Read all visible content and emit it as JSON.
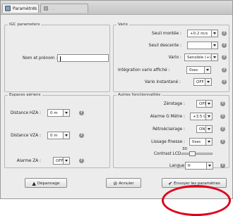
{
  "window": {
    "tab_active": "Paramètres",
    "tab_inactive": "…"
  },
  "igc": {
    "title": "IGC parameters",
    "name_label": "Nom et prénom :",
    "name_value": ""
  },
  "vario": {
    "title": "Vario",
    "seuil_montee_label": "Seuil montée :",
    "seuil_montee_value": "+0.2 m/s",
    "seuil_descente_label": "Seuil descente :",
    "seuil_descente_value": "",
    "vario_label": "Vario :",
    "vario_value": "Sensible (+)",
    "integration_label": "Intégration vario affiché :",
    "integration_value": "0sec",
    "instantane_label": "Vario instantané :",
    "instantane_value": "OFF"
  },
  "espaces": {
    "title": "Espaces aériens",
    "hza_label": "Distance HZA :",
    "hza_value": "0 m",
    "vza_label": "Distance VZA :",
    "vza_value": "0 m",
    "alarme_label": "Alarme ZA :",
    "alarme_value": "OFF"
  },
  "autres": {
    "title": "Autres fonctionnalités",
    "zerotage_label": "Zérotage :",
    "zerotage_value": "OFF",
    "alarme_g_label": "Alarme G Mètre :",
    "alarme_g_value": "+3.5 G",
    "retro_label": "Rétroéclairage :",
    "retro_value": "ON",
    "lissage_label": "Lissage finesse :",
    "lissage_value": "0sec",
    "contrast_label": "Contrast LCD",
    "contrast_value": "30",
    "contrast_level": 0.3,
    "langue_label": "Langue",
    "langue_value": "fr"
  },
  "buttons": {
    "depannage": "Dépannage",
    "annuler": "Annuler",
    "envoyer": "Envoyer les paramètres"
  },
  "icons": {
    "help": "?"
  },
  "colors": {
    "annotation_red": "#e0001e"
  }
}
